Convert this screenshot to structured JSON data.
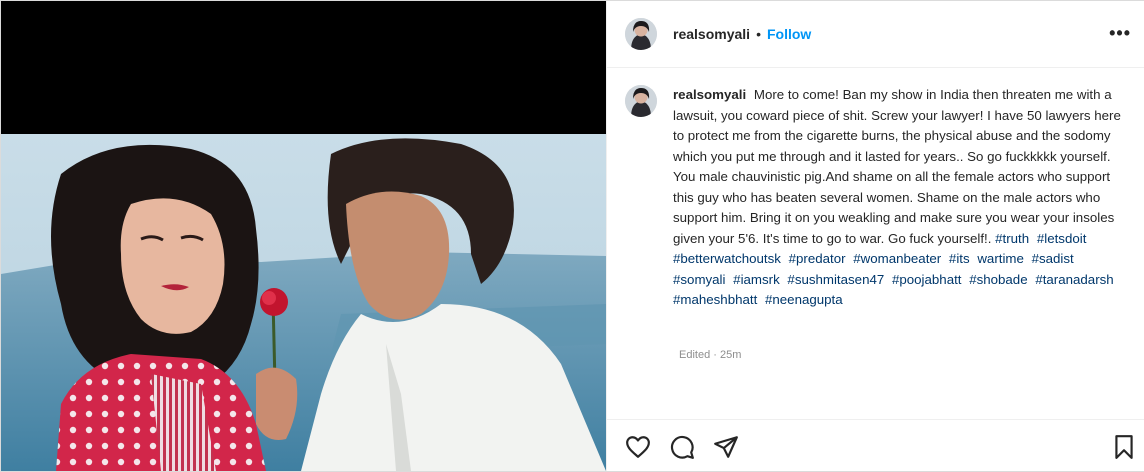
{
  "post": {
    "username": "realsomyali",
    "separator": "•",
    "follow_label": "Follow",
    "more_label": "•••",
    "caption": {
      "username": "realsomyali",
      "text": "More to come! Ban my show in India then threaten me with a lawsuit, you coward piece of shit. Screw your lawyer! I have 50 lawyers here to protect me from the cigarette burns, the physical abuse and the sodomy which you put me through and it lasted for years.. So go fuckkkkk yourself. You male chauvinistic pig.And shame on all the female actors who support this guy who has beaten several women. Shame on the male actors who support him. Bring it on you weakling and make sure you wear your insoles given your 5'6. It's time to go to war. Go fuck yourself!.",
      "hashtags": [
        "#truth",
        "#letsdoit",
        "#betterwatchoutsk",
        "#predator",
        "#womanbeater",
        "#its",
        "wartime",
        "#sadist",
        "#somyali",
        "#iamsrk",
        "#sushmitasen47",
        "#poojabhatt",
        "#shobade",
        "#taranadarsh",
        "#maheshbhatt",
        "#neenagupta"
      ]
    },
    "edited_label": "Edited · 25m"
  },
  "actions": {
    "like": "heart-icon",
    "comment": "comment-icon",
    "share": "paper-plane-icon",
    "save": "bookmark-icon"
  },
  "colors": {
    "link": "#0095f6",
    "hashtag": "#00376b",
    "muted": "#8e8e8e"
  }
}
